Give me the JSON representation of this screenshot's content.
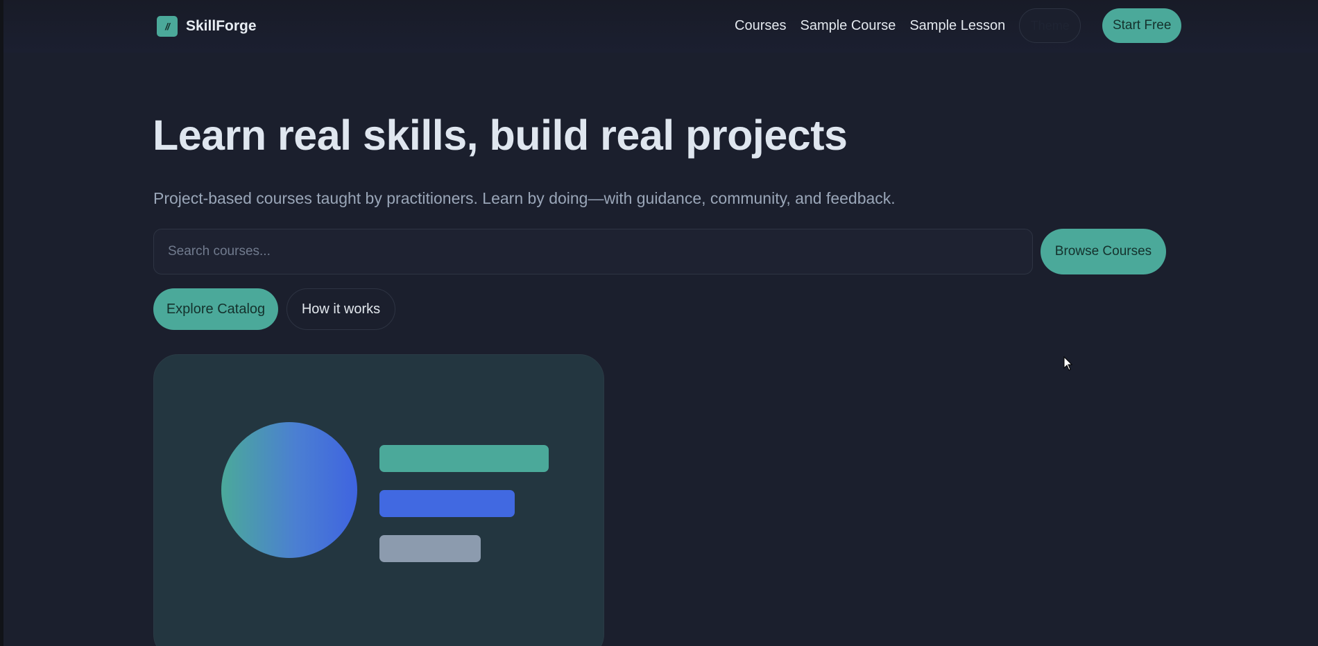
{
  "brand": {
    "logo_glyph": "//",
    "name": "SkillForge",
    "accent_color": "#4ba99a",
    "background_color": "#1b1f2d"
  },
  "nav": {
    "links": [
      "Courses",
      "Sample Course",
      "Sample Lesson"
    ],
    "theme_toggle_label": "Theme",
    "start_label": "Start Free"
  },
  "hero": {
    "title": "Learn real skills, build real projects",
    "subtitle": "Project-based courses taught by practitioners. Learn by doing—with guidance, community, and feedback."
  },
  "search": {
    "placeholder": "Search courses...",
    "value": "",
    "button_label": "Browse Courses"
  },
  "cta": {
    "primary_label": "Explore Catalog",
    "secondary_label": "How it works"
  },
  "illustration": {
    "circle_gradient": [
      "#4ba99a",
      "#3f64e0"
    ],
    "bar_colors": [
      "#4ba99a",
      "#4169e1",
      "#8c9bae"
    ]
  }
}
